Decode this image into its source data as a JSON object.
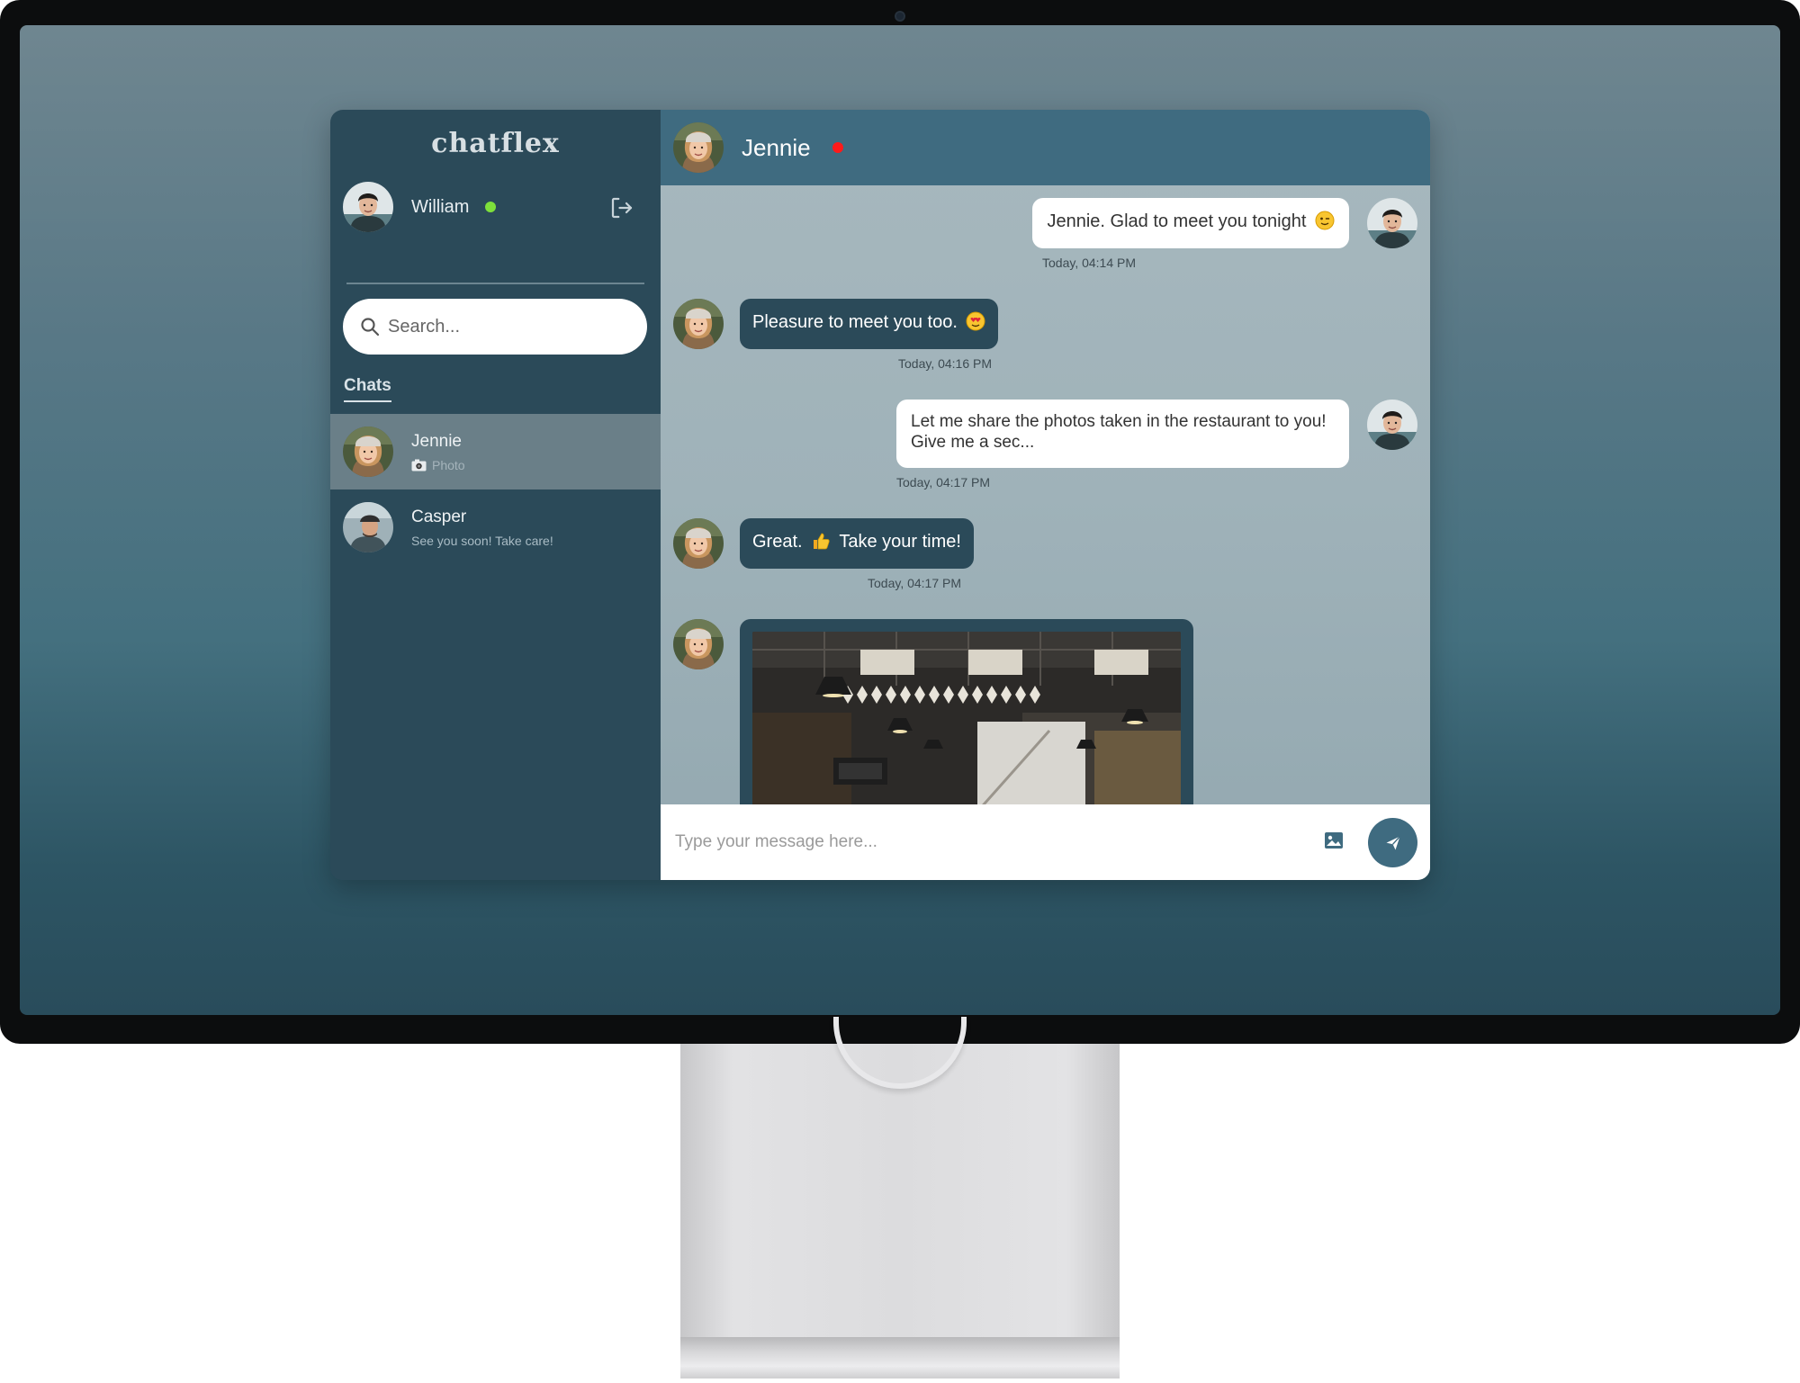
{
  "app": {
    "logo": "chatflex",
    "current_user": {
      "name": "William",
      "status": "online",
      "status_color": "#7ee03b"
    },
    "search": {
      "placeholder": "Search..."
    },
    "chats_label": "Chats",
    "chats": [
      {
        "name": "Jennie",
        "preview": "Photo",
        "preview_icon": "camera-icon",
        "active": true
      },
      {
        "name": "Casper",
        "preview": "See you soon! Take care!",
        "active": false
      }
    ]
  },
  "conversation": {
    "contact": {
      "name": "Jennie",
      "status": "away",
      "status_color": "#ff1a1a"
    },
    "messages": [
      {
        "from": "me",
        "text": "Jennie. Glad to meet you tonight",
        "emoji": "wink-emoji",
        "time": "Today, 04:14 PM"
      },
      {
        "from": "them",
        "text": "Pleasure to meet you too.",
        "emoji": "heart-eyes-emoji",
        "time": "Today, 04:16 PM"
      },
      {
        "from": "me",
        "line1": "Let me share the photos taken in the restaurant to you!",
        "line2": "Give me a sec...",
        "time": "Today, 04:17 PM"
      },
      {
        "from": "them",
        "text_before": "Great.",
        "emoji": "thumbs-up-emoji",
        "text_after": "Take your time!",
        "time": "Today, 04:17 PM"
      },
      {
        "from": "them",
        "type": "photo",
        "subject": "restaurant interior"
      }
    ],
    "composer": {
      "placeholder": "Type your message here...",
      "attach_icon": "image-icon",
      "send_icon": "paper-plane-icon"
    }
  },
  "colors": {
    "sidebar": "#2b4a59",
    "header": "#3f6b80",
    "incoming_bubble": "#2b4a59",
    "outgoing_bubble": "#ffffff"
  }
}
